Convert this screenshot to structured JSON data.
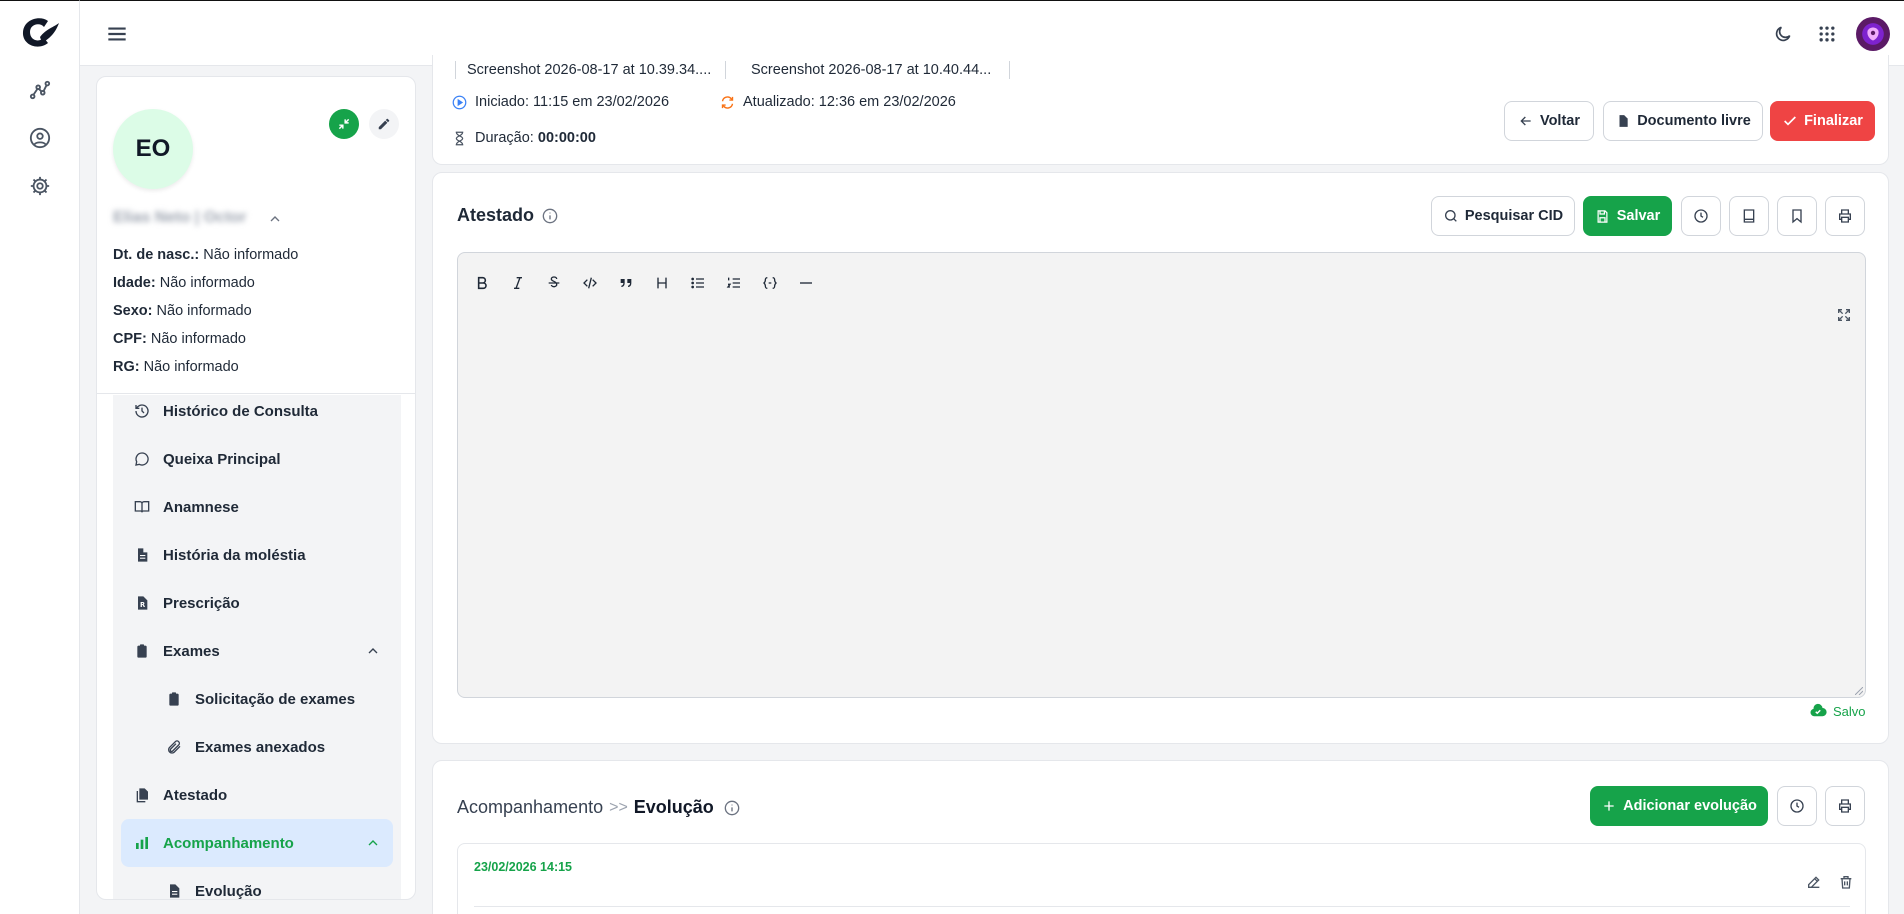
{
  "patient": {
    "initials": "EO",
    "name": "Elias Neto | Octor",
    "fields": [
      {
        "label": "Dt. de nasc.:",
        "value": "Não informado"
      },
      {
        "label": "Idade:",
        "value": "Não informado"
      },
      {
        "label": "Sexo:",
        "value": "Não informado"
      },
      {
        "label": "CPF:",
        "value": "Não informado"
      },
      {
        "label": "RG:",
        "value": "Não informado"
      }
    ]
  },
  "nav": {
    "items": [
      {
        "label": "Histórico de Consulta",
        "icon": "history-icon"
      },
      {
        "label": "Queixa Principal",
        "icon": "chat-bubble-icon"
      },
      {
        "label": "Anamnese",
        "icon": "book-open-icon"
      },
      {
        "label": "História da moléstia",
        "icon": "document-icon"
      },
      {
        "label": "Prescrição",
        "icon": "prescription-icon"
      },
      {
        "label": "Exames",
        "icon": "clipboard-icon"
      },
      {
        "label": "Solicitação de exames",
        "icon": "clipboard-icon"
      },
      {
        "label": "Exames anexados",
        "icon": "paperclip-icon"
      },
      {
        "label": "Atestado",
        "icon": "documents-icon"
      },
      {
        "label": "Acompanhamento",
        "icon": "bar-chart-icon"
      },
      {
        "label": "Evolução",
        "icon": "document-icon"
      }
    ]
  },
  "attachments": [
    "Screenshot 2026-08-17 at 10.39.34....",
    "Screenshot 2026-08-17 at 10.40.44..."
  ],
  "session": {
    "started_label": "Iniciado:",
    "started_value": "11:15 em 23/02/2026",
    "updated_label": "Atualizado:",
    "updated_value": "12:36 em 23/02/2026",
    "duration_label": "Duração:",
    "duration_value": "00:00:00"
  },
  "actions": {
    "back": "Voltar",
    "free_doc": "Documento livre",
    "finish": "Finalizar"
  },
  "atestado": {
    "title": "Atestado",
    "search_cid": "Pesquisar CID",
    "save": "Salvar",
    "saved_status": "Salvo"
  },
  "followup": {
    "crumb_parent": "Acompanhamento",
    "crumb_sep": ">>",
    "crumb_current": "Evolução",
    "add_button": "Adicionar evolução",
    "entry_date": "23/02/2026 14:15"
  },
  "colors": {
    "primary_green": "#16a34a",
    "danger_red": "#ef4444",
    "active_nav_bg": "#dbeafe",
    "avatar_bg": "#dcfce7"
  }
}
